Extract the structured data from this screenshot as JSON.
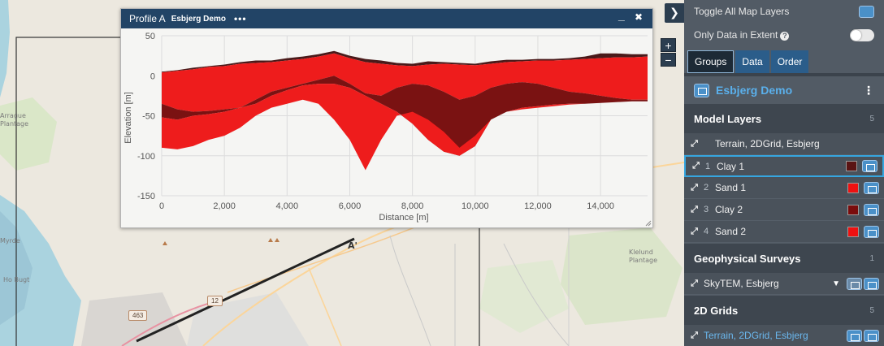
{
  "map": {
    "labels": [
      "Arrague",
      "Plantage",
      "Klelund",
      "Plantage",
      "Ho Bugt",
      "Myrde"
    ],
    "roads": [
      "12",
      "463"
    ],
    "profile_marker": "A'"
  },
  "zoom": {
    "in": "+",
    "out": "−"
  },
  "profile": {
    "title": "Profile A",
    "subtitle": "Esbjerg Demo",
    "menu": "•••",
    "minimize": "_",
    "close": "✖"
  },
  "chart_data": {
    "type": "area",
    "xlabel": "Distance [m]",
    "ylabel": "Elevation [m]",
    "xlim": [
      0,
      15500
    ],
    "ylim": [
      -150,
      50
    ],
    "xticks": [
      "0",
      "2,000",
      "4,000",
      "6,000",
      "8,000",
      "10,000",
      "12,000",
      "14,000"
    ],
    "yticks": [
      "50",
      "0",
      "-50",
      "-100",
      "-150"
    ],
    "grid": true,
    "x": [
      0,
      500,
      1000,
      1500,
      2000,
      2500,
      3000,
      3500,
      4000,
      4500,
      5000,
      5500,
      6000,
      6500,
      7000,
      7500,
      8000,
      8500,
      9000,
      9500,
      10000,
      10500,
      11000,
      11500,
      12000,
      12500,
      13000,
      13500,
      14000,
      14500,
      15000,
      15500
    ],
    "series": [
      {
        "name": "Clay 1",
        "color": "#4a1a1a",
        "top": [
          5,
          7,
          10,
          12,
          14,
          17,
          19,
          19,
          22,
          24,
          27,
          31,
          25,
          21,
          19,
          16,
          15,
          18,
          17,
          16,
          15,
          18,
          20,
          20,
          21,
          21,
          22,
          24,
          28,
          28,
          27,
          27
        ]
      },
      {
        "name": "Sand 1",
        "color": "#ee1c1c",
        "top": [
          4,
          6,
          8,
          11,
          12,
          15,
          16,
          17,
          19,
          21,
          24,
          28,
          22,
          17,
          15,
          13,
          12,
          14,
          15,
          14,
          13,
          15,
          17,
          18,
          19,
          19,
          20,
          21,
          22,
          23,
          23,
          24
        ]
      },
      {
        "name": "Clay 2",
        "color": "#7a1212",
        "top": [
          -35,
          -42,
          -45,
          -44,
          -42,
          -40,
          -30,
          -20,
          -15,
          -10,
          -5,
          0,
          -10,
          -22,
          -25,
          -15,
          -10,
          -12,
          -20,
          -30,
          -25,
          -15,
          -10,
          -8,
          -10,
          -15,
          -20,
          -22,
          -25,
          -28,
          -30,
          -30
        ],
        "bottom": [
          -52,
          -55,
          -50,
          -48,
          -45,
          -40,
          -35,
          -25,
          -18,
          -12,
          -10,
          -10,
          -15,
          -25,
          -35,
          -45,
          -60,
          -80,
          -95,
          -100,
          -88,
          -55,
          -45,
          -40,
          -38,
          -36,
          -35,
          -35,
          -34,
          -33,
          -32,
          -32
        ]
      },
      {
        "name": "Sand 2",
        "color": "#ee1c1c",
        "bottom": [
          -90,
          -92,
          -88,
          -80,
          -75,
          -65,
          -50,
          -40,
          -35,
          -30,
          -35,
          -55,
          -80,
          -118,
          -80,
          -50,
          -45,
          -55,
          -70,
          -90,
          -75,
          -55,
          -45,
          -42,
          -40,
          -38,
          -36,
          -35,
          -34,
          -33,
          -32,
          -32
        ]
      }
    ]
  },
  "sidebar": {
    "toggle_all_label": "Toggle All Map Layers",
    "only_extent_label": "Only Data in Extent",
    "info": "?",
    "tabs": [
      {
        "label": "Groups"
      },
      {
        "label": "Data"
      },
      {
        "label": "Order"
      }
    ],
    "project": "Esbjerg Demo",
    "project_menu": "⋮",
    "groups": [
      {
        "name": "Model Layers",
        "count": "5"
      },
      {
        "name": "Geophysical Surveys",
        "count": "1"
      },
      {
        "name": "2D Grids",
        "count": "5"
      }
    ],
    "model_layers": [
      {
        "num": "",
        "name": "Terrain, 2DGrid, Esbjerg"
      },
      {
        "num": "1",
        "name": "Clay 1",
        "color": "#5a1414"
      },
      {
        "num": "2",
        "name": "Sand 1",
        "color": "#ee1111"
      },
      {
        "num": "3",
        "name": "Clay 2",
        "color": "#7a0c0c"
      },
      {
        "num": "4",
        "name": "Sand 2",
        "color": "#ee1111"
      }
    ],
    "survey_layers": [
      {
        "name": "SkyTEM, Esbjerg"
      }
    ],
    "grid_layers": [
      {
        "name": "Terrain, 2DGrid, Esbjerg"
      }
    ]
  }
}
